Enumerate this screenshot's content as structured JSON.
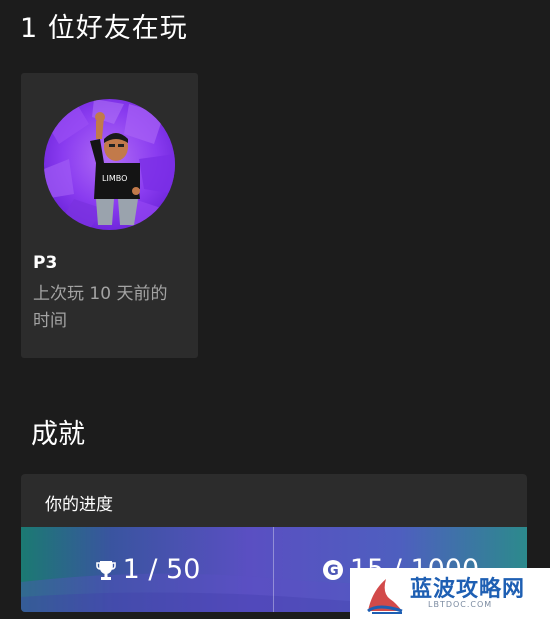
{
  "friends_section": {
    "title": "1 位好友在玩"
  },
  "friend_card": {
    "name": "P3",
    "status": "上次玩 10 天前的时间",
    "avatar_shirt_text": "LIMBO",
    "avatar_bg_color": "#8a3cf0"
  },
  "achievements_section": {
    "title": "成就",
    "progress_header": "你的进度",
    "achievements_count": "1 / 50",
    "gamerscore": "15 / 1000",
    "trophy_icon": "trophy-icon",
    "gamerscore_icon": "gamerscore-g-icon"
  },
  "watermark": {
    "title": "蓝波攻略网",
    "subtitle": "LBTDOC.COM"
  }
}
